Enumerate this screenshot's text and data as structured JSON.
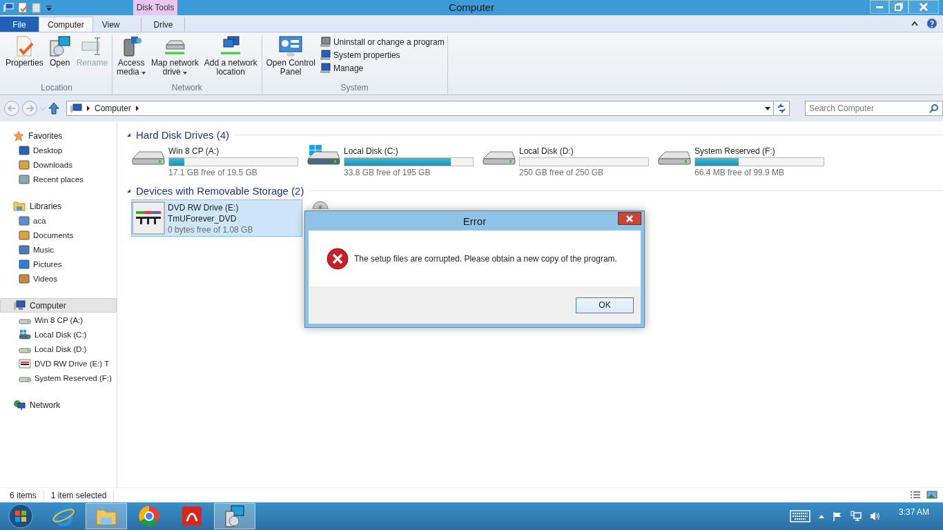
{
  "window": {
    "title": "Computer"
  },
  "context_tab": {
    "label": "Disk Tools"
  },
  "tabs": [
    {
      "label": "File",
      "kind": "file",
      "selected": false
    },
    {
      "label": "Computer",
      "kind": "tab",
      "selected": true
    },
    {
      "label": "View",
      "kind": "tab",
      "selected": false
    },
    {
      "label": "Drive",
      "kind": "tab",
      "selected": false
    }
  ],
  "ribbon_groups": [
    {
      "label": "Location",
      "kind": "large",
      "items": [
        {
          "label": "Properties",
          "dropdown": false,
          "disabled": false
        },
        {
          "label": "Open",
          "dropdown": false,
          "disabled": false
        },
        {
          "label": "Rename",
          "dropdown": false,
          "disabled": true
        }
      ]
    },
    {
      "label": "Network",
      "kind": "large",
      "items": [
        {
          "label": "Access\nmedia",
          "dropdown": true,
          "disabled": false
        },
        {
          "label": "Map network\ndrive",
          "dropdown": true,
          "disabled": false
        },
        {
          "label": "Add a network\nlocation",
          "dropdown": false,
          "disabled": false
        }
      ]
    },
    {
      "label": "System",
      "kind": "mixed",
      "items": [
        {
          "label": "Open Control\nPanel",
          "dropdown": false,
          "disabled": false
        }
      ],
      "small_items": [
        {
          "label": "Uninstall or change a program"
        },
        {
          "label": "System properties"
        },
        {
          "label": "Manage"
        }
      ]
    }
  ],
  "address": {
    "breadcrumb": [
      "Computer"
    ]
  },
  "search": {
    "placeholder": "Search Computer"
  },
  "sidebar": {
    "groups": [
      {
        "label": "Favorites",
        "selected": false,
        "children": [
          {
            "label": "Desktop",
            "selected": false
          },
          {
            "label": "Downloads",
            "selected": false
          },
          {
            "label": "Recent places",
            "selected": false
          }
        ]
      },
      {
        "label": "Libraries",
        "selected": false,
        "children": [
          {
            "label": "aca",
            "selected": false
          },
          {
            "label": "Documents",
            "selected": false
          },
          {
            "label": "Music",
            "selected": false
          },
          {
            "label": "Pictures",
            "selected": false
          },
          {
            "label": "Videos",
            "selected": false
          }
        ]
      },
      {
        "label": "Computer",
        "selected": true,
        "children": [
          {
            "label": "Win 8 CP (A:)",
            "selected": false
          },
          {
            "label": "Local Disk (C:)",
            "selected": false
          },
          {
            "label": "Local Disk (D:)",
            "selected": false
          },
          {
            "label": "DVD RW Drive (E:) T",
            "selected": false
          },
          {
            "label": "System Reserved (F:)",
            "selected": false
          }
        ]
      },
      {
        "label": "Network",
        "selected": false
      }
    ]
  },
  "sections": [
    {
      "title": "Hard Disk Drives (4)",
      "kind": "disks",
      "items": [
        {
          "name": "Win 8 CP (A:)",
          "free": "17.1 GB free of 19.5 GB",
          "level": 0.12,
          "selected": false
        },
        {
          "name": "Local Disk (C:)",
          "free": "33.8 GB free of 195 GB",
          "level": 0.83,
          "selected": false
        },
        {
          "name": "Local Disk (D:)",
          "free": "250 GB free of 250 GB",
          "level": 0,
          "selected": false
        },
        {
          "name": "System Reserved (F:)",
          "free": "66.4 MB free of 99.9 MB",
          "level": 0.34,
          "selected": false
        }
      ]
    },
    {
      "title": "Devices with Removable Storage (2)",
      "kind": "removable",
      "items": [
        {
          "name": "DVD RW Drive (E:)",
          "volume": "TmUForever_DVD",
          "free": "0 bytes free of 1.08 GB",
          "selected": true
        }
      ]
    }
  ],
  "status_bar": {
    "count": "6 items",
    "selection": "1 item selected"
  },
  "dialog": {
    "title": "Error",
    "message": "The setup files are corrupted. Please obtain a new copy of the program.",
    "button": "OK"
  },
  "taskbar": {
    "apps": [
      {
        "active": false
      },
      {
        "active": true
      },
      {
        "active": false
      },
      {
        "active": false
      },
      {
        "active": true
      }
    ],
    "time": "3:37 AM"
  }
}
